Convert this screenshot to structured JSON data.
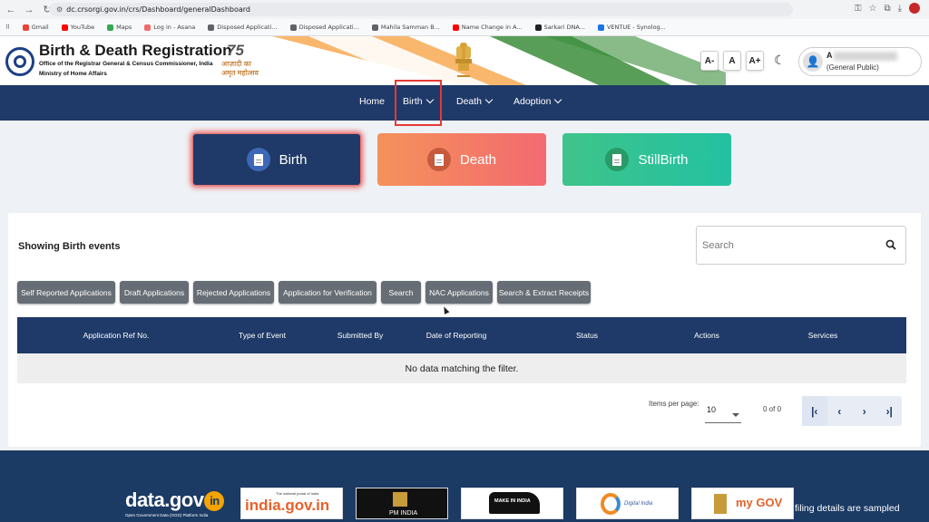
{
  "browser": {
    "url": "dc.crsorgi.gov.in/crs/Dashboard/generalDashboard",
    "bookmarks": [
      {
        "label": "Gmail",
        "color": "#ea4335"
      },
      {
        "label": "YouTube",
        "color": "#ff0000"
      },
      {
        "label": "Maps",
        "color": "#34a853"
      },
      {
        "label": "Log in - Asana",
        "color": "#f06a6a"
      },
      {
        "label": "Disposed Applicati...",
        "color": "#5f6368"
      },
      {
        "label": "Disposed Applicati...",
        "color": "#5f6368"
      },
      {
        "label": "Mahila Samman B...",
        "color": "#5f6368"
      },
      {
        "label": "Name Change in A...",
        "color": "#ff0000"
      },
      {
        "label": "Sarkari DNA...",
        "color": "#202124"
      },
      {
        "label": "VENTUE - Synolog...",
        "color": "#1a73e8"
      }
    ]
  },
  "header": {
    "title": "Birth & Death Registration",
    "subtitle1": "Office of the Registrar General & Census Commissioner, India",
    "subtitle2": "Ministry of Home Affairs",
    "azadi_number": "75",
    "azadi_text1": "आज़ादी का",
    "azadi_text2": "अमृत महोत्सव",
    "font_buttons": [
      "A-",
      "A",
      "A+"
    ],
    "user_initial": "A",
    "user_role": "(General Public)"
  },
  "nav": {
    "items": [
      "Home",
      "Birth",
      "Death",
      "Adoption"
    ]
  },
  "event_cards": {
    "birth": "Birth",
    "death": "Death",
    "stillbirth": "StillBirth"
  },
  "panel": {
    "title": "Showing Birth events",
    "search_placeholder": "Search",
    "filters": [
      "Self Reported Applications",
      "Draft Applications",
      "Rejected Applications",
      "Application for Verification",
      "Search",
      "NAC Applications",
      "Search & Extract Receipts"
    ],
    "columns": [
      "Application Ref No.",
      "Type of Event",
      "Submitted By",
      "Date of Reporting",
      "Status",
      "Actions",
      "Services"
    ],
    "empty_message": "No data matching the filter.",
    "items_per_page_label": "Items per page:",
    "items_per_page": "10",
    "range_label": "0 of 0"
  },
  "footer": {
    "data_gov": "data.gov",
    "data_gov_in": "in",
    "data_gov_sub": "Open Government Data (OGD) Platform India",
    "india_gov": "india.gov.in",
    "india_gov_sub": "The national portal of India",
    "pm_india": "PM INDIA",
    "make_in_india": "MAKE IN INDIA",
    "digital_india": "Digital India",
    "mygov": "my GOV",
    "note": "filing details are sampled"
  },
  "colors": {
    "navy": "#1f3a68",
    "death_gradient_start": "#f4925a",
    "death_gradient_end": "#f36a70",
    "stillbirth_gradient_start": "#3ec48a",
    "highlight": "#e53935"
  }
}
